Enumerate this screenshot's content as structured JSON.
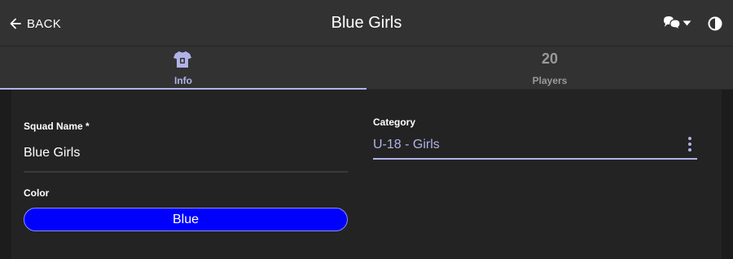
{
  "header": {
    "back_label": "BACK",
    "title": "Blue Girls",
    "icons": {
      "back": "arrow-left-icon",
      "chat": "chat-bubbles-icon",
      "dropdown": "caret-down-icon",
      "theme": "half-circle-contrast-icon"
    }
  },
  "tabs": [
    {
      "label": "Info",
      "icon": "jersey-icon",
      "active": true
    },
    {
      "label": "Players",
      "count": "20",
      "active": false
    }
  ],
  "form": {
    "squad_name_label": "Squad Name *",
    "squad_name_value": "Blue Girls",
    "color_label": "Color",
    "color_value": "Blue",
    "color_hex": "#0000ff",
    "category_label": "Category",
    "category_value": "U-18 - Girls",
    "category_more_icon": "more-vertical-icon"
  },
  "colors": {
    "accent": "#b0b3e8",
    "header_bg": "#323232",
    "page_bg": "#1c1c1c",
    "card_bg": "#232323"
  }
}
